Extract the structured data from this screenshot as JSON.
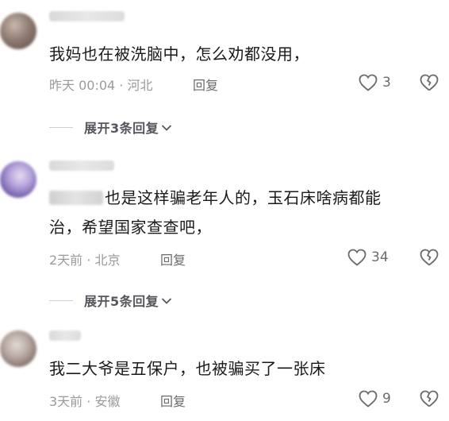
{
  "comments": [
    {
      "text": "我妈也在被洗脑中，怎么劝都没用，",
      "time": "昨天 00:04",
      "separator": "·",
      "location": "河北",
      "reply_label": "回复",
      "like_count": "3",
      "expand_label": "展开3条回复",
      "colors": [
        "#7a6a63",
        "#c9b8ae",
        "#e4dcd6"
      ]
    },
    {
      "text_line1": "也是这样骗老年人的，玉石床啥病都能",
      "text_line2": "治，希望国家查查吧，",
      "time": "2天前",
      "separator": "·",
      "location": "北京",
      "reply_label": "回复",
      "like_count": "34",
      "expand_label": "展开5条回复",
      "colors": [
        "#6f5aa8",
        "#b8a6dc",
        "#e5dcf0"
      ]
    },
    {
      "text": "我二大爷是五保户，也被骗买了一张床",
      "time": "3天前",
      "separator": "·",
      "location": "安徽",
      "reply_label": "回复",
      "like_count": "9",
      "colors": [
        "#8a7a74",
        "#c7bab3",
        "#e2dad5"
      ]
    }
  ]
}
